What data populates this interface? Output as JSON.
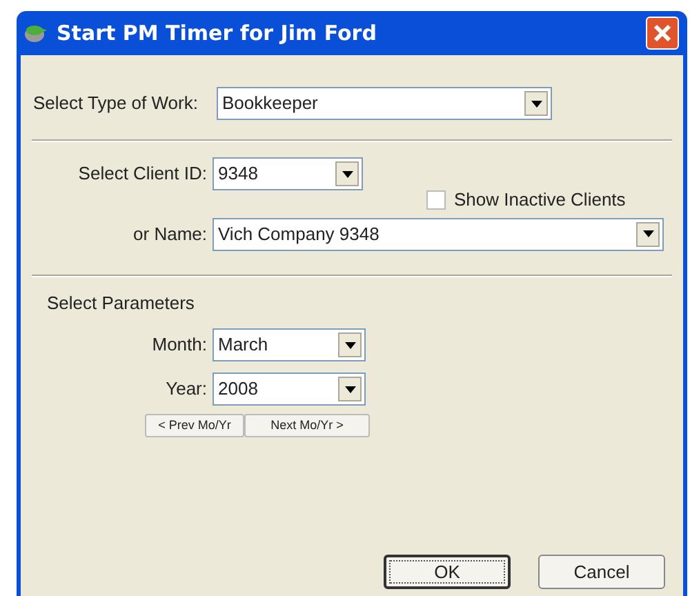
{
  "window": {
    "title": "Start PM Timer for Jim Ford"
  },
  "work_type": {
    "label": "Select Type of Work:",
    "value": "Bookkeeper"
  },
  "client_id": {
    "label": "Select Client ID:",
    "value": "9348"
  },
  "show_inactive": {
    "label": "Show Inactive Clients",
    "checked": false
  },
  "client_name": {
    "label": "or Name:",
    "value": "Vich Company 9348"
  },
  "parameters": {
    "heading": "Select Parameters",
    "month": {
      "label": "Month:",
      "value": "March"
    },
    "year": {
      "label": "Year:",
      "value": "2008"
    },
    "prev_button": "< Prev Mo/Yr",
    "next_button": "Next Mo/Yr >"
  },
  "buttons": [
    {
      "label": "OK",
      "default": true
    },
    {
      "label": "Cancel",
      "default": false
    }
  ]
}
